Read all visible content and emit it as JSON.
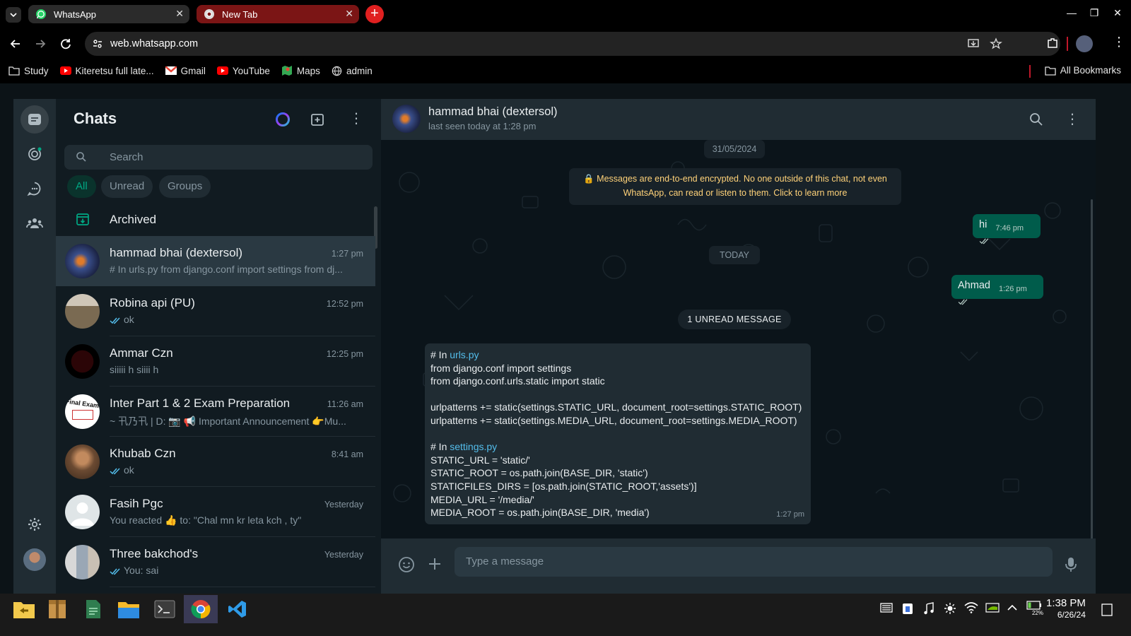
{
  "browser": {
    "tabs": [
      {
        "label": "WhatsApp",
        "icon": "whatsapp-icon"
      },
      {
        "label": "New Tab",
        "icon": "chrome-icon"
      }
    ],
    "url": "web.whatsapp.com",
    "bookmarks": [
      {
        "label": "Study",
        "icon": "folder-icon"
      },
      {
        "label": "Kiteretsu full late...",
        "icon": "youtube-icon"
      },
      {
        "label": "Gmail",
        "icon": "gmail-icon"
      },
      {
        "label": "YouTube",
        "icon": "youtube-icon"
      },
      {
        "label": "Maps",
        "icon": "maps-icon"
      },
      {
        "label": "admin",
        "icon": "globe-icon"
      }
    ],
    "all_bookmarks": "All Bookmarks"
  },
  "sidebar": {
    "title": "Chats",
    "search_placeholder": "Search",
    "filters": [
      "All",
      "Unread",
      "Groups"
    ],
    "archived_label": "Archived",
    "chats": [
      {
        "name": "hammad bhai (dextersol)",
        "time": "1:27 pm",
        "preview": "# In urls.py from django.conf import settings from dj...",
        "ticks": false,
        "selected": true
      },
      {
        "name": "Robina api (PU)",
        "time": "12:52 pm",
        "preview": "ok",
        "ticks": true
      },
      {
        "name": "Ammar Czn",
        "time": "12:25 pm",
        "preview": "siiiii h siiii h",
        "ticks": false
      },
      {
        "name": "Inter Part 1 & 2 Exam Preparation",
        "time": "11:26 am",
        "preview": "~ 卂乃卂 | D: 📷 📢 Important Announcement 👉Mu...",
        "ticks": false
      },
      {
        "name": "Khubab Czn",
        "time": "8:41 am",
        "preview": "ok",
        "ticks": true
      },
      {
        "name": "Fasih Pgc",
        "time": "Yesterday",
        "preview": "You reacted 👍 to: \"Chal mn kr leta kch , ty\"",
        "ticks": false
      },
      {
        "name": "Three bakchod's",
        "time": "Yesterday",
        "preview": "You: sai",
        "ticks": true
      }
    ],
    "avatar_label_inter": "Final Exam"
  },
  "conversation": {
    "contact_name": "hammad bhai (dextersol)",
    "status": "last seen today at 1:28 pm",
    "date_1": "31/05/2024",
    "encryption_notice": "🔒 Messages are end-to-end encrypted. No one outside of this chat, not even WhatsApp, can read or listen to them. Click to learn more",
    "msg_hi": {
      "text": "hi",
      "time": "7:46 pm"
    },
    "date_2": "TODAY",
    "msg_ahmad": {
      "text": "Ahmad",
      "time": "1:26 pm"
    },
    "unread_label": "1 UNREAD MESSAGE",
    "incoming": {
      "l1_prefix": "# In ",
      "l1_link": "urls.py",
      "l2": "from django.conf import settings",
      "l3": "from django.conf.urls.static import static",
      "l4": "",
      "l5": "urlpatterns += static(settings.STATIC_URL, document_root=settings.STATIC_ROOT)",
      "l6": "urlpatterns += static(settings.MEDIA_URL, document_root=settings.MEDIA_ROOT)",
      "l7": "",
      "l8_prefix": "# In ",
      "l8_link": "settings.py",
      "l9": "STATIC_URL = 'static/'",
      "l10": "STATIC_ROOT = os.path.join(BASE_DIR, 'static')",
      "l11": "STATICFILES_DIRS = [os.path.join(STATIC_ROOT,'assets')]",
      "l12": "MEDIA_URL = '/media/'",
      "l13": "MEDIA_ROOT = os.path.join(BASE_DIR, 'media')",
      "time": "1:27 pm"
    },
    "compose_placeholder": "Type a message"
  },
  "taskbar": {
    "time": "1:38 PM",
    "date": "6/26/24",
    "battery": "22%"
  },
  "colors": {
    "accent": "#00a884",
    "outgoing_bubble": "#005c4b",
    "incoming_bubble": "#202c33",
    "link": "#53bdeb"
  }
}
